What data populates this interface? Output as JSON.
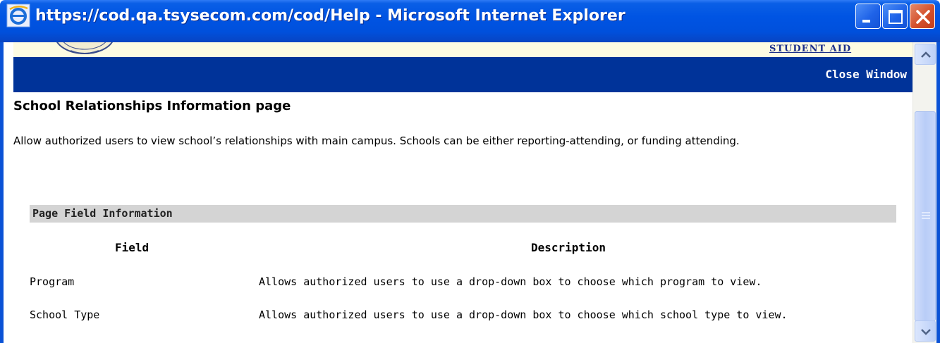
{
  "window": {
    "title": "https://cod.qa.tsysecom.com/cod/Help - Microsoft Internet Explorer"
  },
  "banner": {
    "student_aid_label": "STUDENT AID"
  },
  "navbar": {
    "close_window_label": "Close Window"
  },
  "page": {
    "title": "School Relationships Information page",
    "intro": "Allow authorized users to view school’s relationships with main campus. Schools can be either reporting-attending, or funding attending."
  },
  "field_info": {
    "section_title": "Page Field Information",
    "columns": [
      "Field",
      "Description"
    ],
    "rows": [
      {
        "field": "Program",
        "description": "Allows authorized users to use a drop-down box to choose which program to view."
      },
      {
        "field": "School Type",
        "description": "Allows authorized users to use a drop-down box to choose which school type to view."
      }
    ]
  },
  "icons": {
    "title": "ie-icon",
    "minimize": "minimize-icon",
    "maximize": "maximize-icon",
    "close": "close-icon",
    "scroll_up": "chevron-up-icon",
    "scroll_down": "chevron-down-icon"
  },
  "colors": {
    "titlebar": "#0054e3",
    "navbar": "#003399",
    "section_header_bg": "#d4d4d4",
    "banner_bg": "#fdfbe2",
    "student_aid_text": "#1b2f8a",
    "close_button": "#d4502c"
  }
}
